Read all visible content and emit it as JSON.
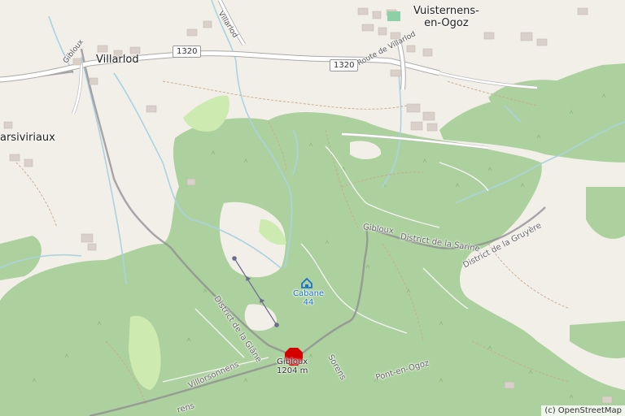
{
  "map": {
    "places": {
      "vuisternens_line1": "Vuisternens-",
      "vuisternens_line2": "en-Ogoz",
      "villarlod": "Villarlod",
      "sivirieux": "arsiviriaux"
    },
    "roads": {
      "shield_1320_a": "1320",
      "shield_1320_b": "1320",
      "route_villarlod": "Route de Villarlod",
      "villarlod_vertical": "Villarlod",
      "gibloux_road": "Gibloux"
    },
    "admin": {
      "district_sarine": "District de la Sarine",
      "district_gruyere": "District de la Gruyère",
      "district_glane": "District de la Glâne",
      "gibloux_boundary": "Gibloux",
      "villorsonnens": "Villorsonnens",
      "sorens": "Sorens",
      "pont_en_ogoz": "Pont-en-Ogoz",
      "bottom_left": "rens"
    },
    "pois": {
      "cabane_line1": "Cabane",
      "cabane_line2": "44",
      "peak_name": "Gibloux",
      "peak_elevation": "1204 m"
    },
    "attribution": "(c) OpenStreetMap",
    "colors": {
      "forest": "#add19e",
      "land": "#f2efe9",
      "meadow": "#cdebb0",
      "water": "#aad3df",
      "road": "#ffffff",
      "building": "#d9d0c9",
      "peak": "#d40000"
    }
  }
}
